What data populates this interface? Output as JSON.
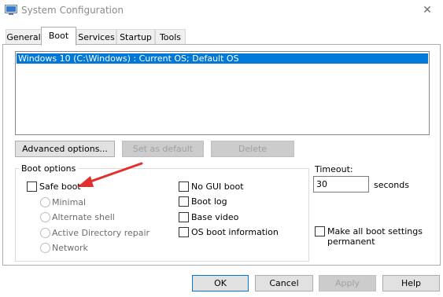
{
  "window": {
    "title": "System Configuration",
    "close_glyph": "✕"
  },
  "tabs": [
    {
      "label": "General",
      "active": false
    },
    {
      "label": "Boot",
      "active": true
    },
    {
      "label": "Services",
      "active": false
    },
    {
      "label": "Startup",
      "active": false
    },
    {
      "label": "Tools",
      "active": false
    }
  ],
  "os_list": {
    "items": [
      "Windows 10 (C:\\Windows) : Current OS; Default OS"
    ],
    "selected_index": 0
  },
  "list_buttons": {
    "advanced": "Advanced options...",
    "set_default": "Set as default",
    "delete": "Delete"
  },
  "boot_options": {
    "title": "Boot options",
    "safe_boot": {
      "label": "Safe boot",
      "checked": false
    },
    "safe_modes": [
      "Minimal",
      "Alternate shell",
      "Active Directory repair",
      "Network"
    ],
    "no_gui_boot": "No GUI boot",
    "boot_log": "Boot log",
    "base_video": "Base video",
    "os_boot_info": "OS boot information"
  },
  "timeout": {
    "label": "Timeout:",
    "value": "30",
    "unit": "seconds"
  },
  "permanent": {
    "label_line1": "Make all boot settings",
    "label_line2": "permanent",
    "checked": false
  },
  "footer": {
    "ok": "OK",
    "cancel": "Cancel",
    "apply": "Apply",
    "help": "Help"
  },
  "colors": {
    "selection": "#0078d7",
    "annotation_arrow": "#e03131"
  },
  "annotation": {
    "type": "red-arrow",
    "points_to": "safe-boot-checkbox"
  }
}
